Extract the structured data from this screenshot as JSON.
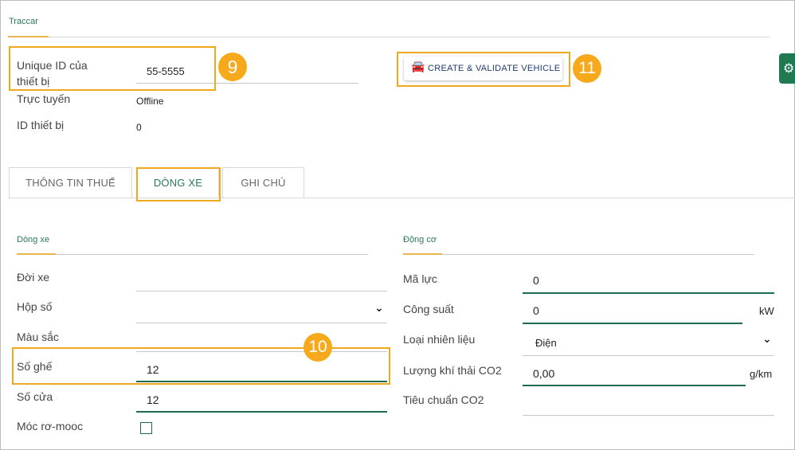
{
  "header": {
    "tab_label": "Traccar"
  },
  "device": {
    "unique_id_label": "Unique ID của thiết bị",
    "unique_id_value": "55-5555",
    "online_label": "Trực tuyến",
    "online_value": "Offline",
    "device_id_label": "ID thiết bị",
    "device_id_value": "0"
  },
  "actions": {
    "create_validate_label": "CREATE & VALIDATE VEHICLE"
  },
  "tabs": [
    {
      "label": "THÔNG TIN THUẾ"
    },
    {
      "label": "DÒNG XE"
    },
    {
      "label": "GHI CHÚ"
    }
  ],
  "vehicle_line": {
    "section_title": "Dòng xe",
    "model_year_label": "Đời xe",
    "model_year_value": "",
    "gearbox_label": "Hộp số",
    "gearbox_value": "",
    "color_label": "Màu sắc",
    "color_value": "",
    "seats_label": "Số ghế",
    "seats_value": "12",
    "doors_label": "Số cửa",
    "doors_value": "12",
    "trailer_label": "Móc rơ-mooc",
    "trailer_checked": false
  },
  "engine": {
    "section_title": "Động cơ",
    "horsepower_label": "Mã lực",
    "horsepower_value": "0",
    "power_label": "Công suất",
    "power_value": "0",
    "power_unit": "kW",
    "fuel_label": "Loại nhiên liệu",
    "fuel_value": "Điện",
    "co2_label": "Lượng khí thải CO2",
    "co2_value": "0,00",
    "co2_unit": "g/km",
    "co2_standard_label": "Tiêu chuẩn CO2",
    "co2_standard_value": ""
  },
  "callouts": {
    "n9": "9",
    "n10": "10",
    "n11": "11"
  },
  "colors": {
    "accent_green": "#1e6b4f",
    "highlight": "#f0a81c",
    "badge": "#f5a91b"
  }
}
